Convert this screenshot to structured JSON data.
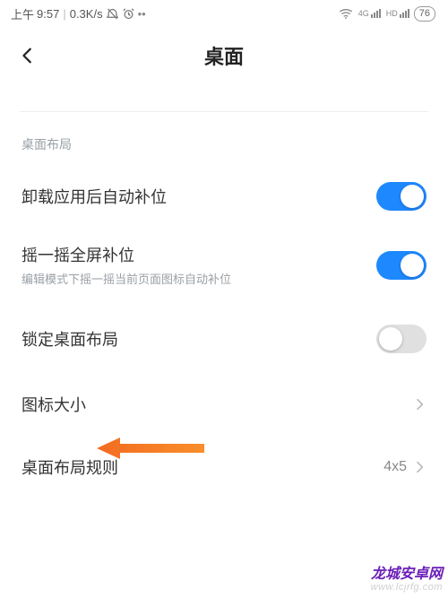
{
  "status": {
    "time_prefix": "上午",
    "time": "9:57",
    "net_speed": "0.3K/s",
    "alarm_icon": "alarm-off-icon",
    "dnd_icon": "dnd-icon",
    "more": "••",
    "wifi_icon": "wifi-icon",
    "sim1_label": "4G",
    "sim2_label": "HD",
    "battery_text": "76"
  },
  "header": {
    "back_icon": "chevron-left-icon",
    "title": "桌面"
  },
  "section": {
    "group_label": "桌面布局",
    "items": [
      {
        "key": "auto_fill",
        "label": "卸载应用后自动补位",
        "sub": "",
        "type": "toggle",
        "on": true
      },
      {
        "key": "shake_fill",
        "label": "摇一摇全屏补位",
        "sub": "编辑模式下摇一摇当前页面图标自动补位",
        "type": "toggle",
        "on": true
      },
      {
        "key": "lock",
        "label": "锁定桌面布局",
        "sub": "",
        "type": "toggle",
        "on": false
      },
      {
        "key": "icon_size",
        "label": "图标大小",
        "sub": "",
        "type": "link",
        "value": ""
      },
      {
        "key": "grid",
        "label": "桌面布局规则",
        "sub": "",
        "type": "link",
        "value": "4x5"
      }
    ]
  },
  "annotation": {
    "arrow_target_key": "icon_size",
    "arrow_color": "#f36b21"
  },
  "watermark": {
    "line1": "龙城安卓网",
    "line2": "www.lcjrfg.com"
  }
}
